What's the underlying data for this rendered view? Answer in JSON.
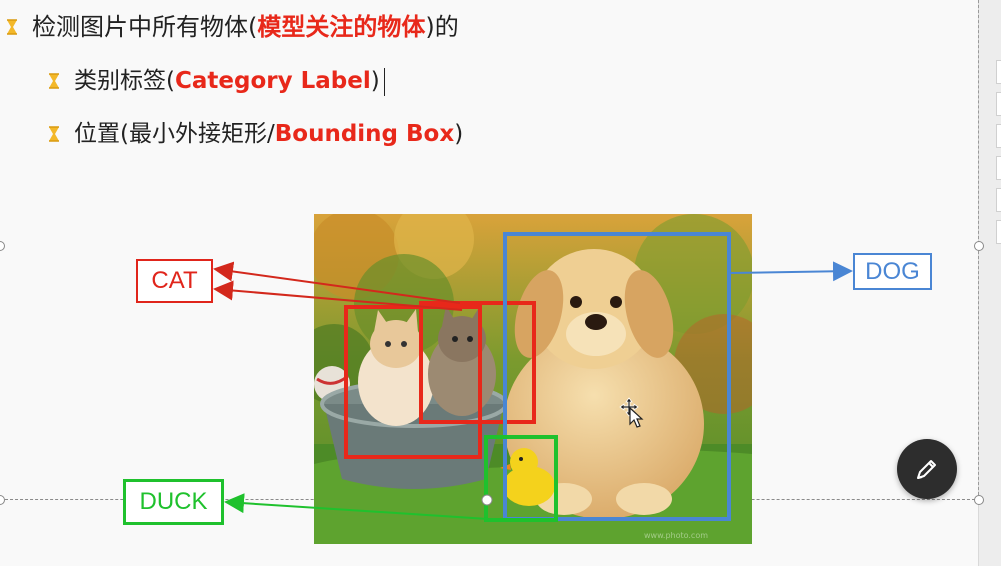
{
  "slide": {
    "line1": {
      "prefix": "检测图片中所有物体(",
      "highlight": "模型关注的物体",
      "suffix": ")的"
    },
    "line2": {
      "prefix": "类别标签(",
      "highlight": "Category Label",
      "suffix": ")"
    },
    "line3": {
      "prefix": "位置(最小外接矩形/",
      "highlight": "Bounding Box",
      "suffix": ")"
    }
  },
  "labels": {
    "cat": "CAT",
    "dog": "DOG",
    "duck": "DUCK"
  },
  "colors": {
    "text": "#222222",
    "highlight": "#e8281a",
    "bullet": "#f3b82a",
    "cat": "#e0251b",
    "dog": "#4a86d4",
    "duck": "#1fc12d",
    "pen_button": "#2d2d2d"
  },
  "icons": {
    "bullet": "hourglass-bullet-icon",
    "pen": "pen-edit-icon",
    "cursor": "move-cursor-icon"
  }
}
